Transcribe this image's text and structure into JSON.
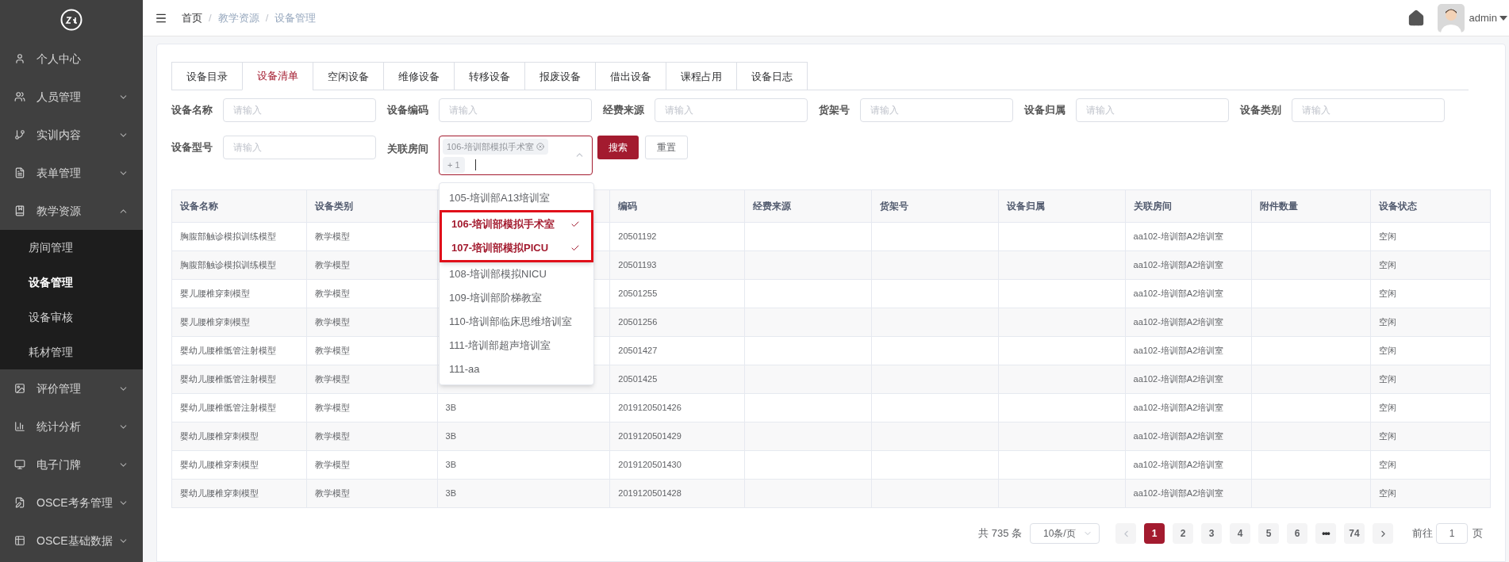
{
  "sidebar": {
    "items": [
      {
        "label": "个人中心"
      },
      {
        "label": "人员管理",
        "expanded": false
      },
      {
        "label": "实训内容",
        "expanded": false
      },
      {
        "label": "表单管理",
        "expanded": false
      },
      {
        "label": "教学资源",
        "expanded": true,
        "children": [
          {
            "label": "房间管理",
            "selected": false
          },
          {
            "label": "设备管理",
            "selected": true
          },
          {
            "label": "设备审核",
            "selected": false
          },
          {
            "label": "耗材管理",
            "selected": false
          }
        ]
      },
      {
        "label": "评价管理",
        "expanded": false
      },
      {
        "label": "统计分析",
        "expanded": false
      },
      {
        "label": "电子门牌",
        "expanded": false
      },
      {
        "label": "OSCE考务管理",
        "expanded": false
      },
      {
        "label": "OSCE基础数据",
        "expanded": false
      }
    ]
  },
  "breadcrumb": {
    "separator": "/",
    "items": [
      "首页",
      "教学资源",
      "设备管理"
    ]
  },
  "user": {
    "name": "admin"
  },
  "tabs": [
    {
      "label": "设备目录",
      "selected": false
    },
    {
      "label": "设备清单",
      "selected": true
    },
    {
      "label": "空闲设备",
      "selected": false
    },
    {
      "label": "维修设备",
      "selected": false
    },
    {
      "label": "转移设备",
      "selected": false
    },
    {
      "label": "报废设备",
      "selected": false
    },
    {
      "label": "借出设备",
      "selected": false
    },
    {
      "label": "课程占用",
      "selected": false
    },
    {
      "label": "设备日志",
      "selected": false
    }
  ],
  "filters": [
    {
      "kind": "input",
      "label": "设备名称",
      "placeholder": "请输入"
    },
    {
      "kind": "input",
      "label": "设备编码",
      "placeholder": "请输入"
    },
    {
      "kind": "input",
      "label": "经费来源",
      "placeholder": "请输入"
    },
    {
      "kind": "input",
      "label": "货架号",
      "placeholder": "请输入"
    },
    {
      "kind": "input",
      "label": "设备归属",
      "placeholder": "请输入"
    },
    {
      "kind": "input",
      "label": "设备类别",
      "placeholder": "请输入"
    },
    {
      "kind": "input",
      "label": "设备型号",
      "placeholder": "请输入"
    },
    {
      "kind": "select",
      "label": "关联房间",
      "tags": [
        "106-培训部模拟手术室"
      ],
      "more": "+ 1",
      "open": true
    }
  ],
  "buttons": [
    {
      "label": "搜索",
      "kind": "primary"
    },
    {
      "label": "重置",
      "kind": "default"
    }
  ],
  "dropdown": {
    "highlight_selected": true,
    "options": [
      {
        "label": "105-培训部A13培训室",
        "selected": false
      },
      {
        "label": "106-培训部模拟手术室",
        "selected": true
      },
      {
        "label": "107-培训部模拟PICU",
        "selected": true
      },
      {
        "label": "108-培训部模拟NICU",
        "selected": false
      },
      {
        "label": "109-培训部阶梯教室",
        "selected": false
      },
      {
        "label": "110-培训部临床思维培训室",
        "selected": false
      },
      {
        "label": "111-培训部超声培训室",
        "selected": false
      },
      {
        "label": "111-aa",
        "selected": false
      }
    ]
  },
  "table": {
    "headers": {
      "column_1": "设备名称",
      "column_2": "设备类别",
      "column_4": "编码",
      "column_5": "经费来源",
      "column_6": "货架号",
      "column_7": "设备归属",
      "column_8": "关联房间",
      "column_9": "附件数量",
      "column_10": "设备状态"
    },
    "rows": [
      {
        "column_1": "胸腹部触诊模拟训练模型",
        "column_2": "教学模型",
        "column_4": "20501192",
        "column_8": "aa102-培训部A2培训室",
        "column_10": "空闲"
      },
      {
        "column_1": "胸腹部触诊模拟训练模型",
        "column_2": "教学模型",
        "column_4": "20501193",
        "column_8": "aa102-培训部A2培训室",
        "column_10": "空闲"
      },
      {
        "column_1": "婴儿腰椎穿刺模型",
        "column_2": "教学模型",
        "column_4": "20501255",
        "column_8": "aa102-培训部A2培训室",
        "column_10": "空闲"
      },
      {
        "column_1": "婴儿腰椎穿刺模型",
        "column_2": "教学模型",
        "column_4": "20501256",
        "column_8": "aa102-培训部A2培训室",
        "column_10": "空闲"
      },
      {
        "column_1": "婴幼儿腰椎骶管注射模型",
        "column_2": "教学模型",
        "column_4": "20501427",
        "column_8": "aa102-培训部A2培训室",
        "column_10": "空闲"
      },
      {
        "column_1": "婴幼儿腰椎骶管注射模型",
        "column_2": "教学模型",
        "column_4": "20501425",
        "column_8": "aa102-培训部A2培训室",
        "column_10": "空闲"
      },
      {
        "column_1": "婴幼儿腰椎骶管注射模型",
        "column_2": "教学模型",
        "column_3": "3B",
        "column_4": "2019120501426",
        "column_8": "aa102-培训部A2培训室",
        "column_10": "空闲"
      },
      {
        "column_1": "婴幼儿腰椎穿刺模型",
        "column_2": "教学模型",
        "column_3": "3B",
        "column_4": "2019120501429",
        "column_8": "aa102-培训部A2培训室",
        "column_10": "空闲"
      },
      {
        "column_1": "婴幼儿腰椎穿刺模型",
        "column_2": "教学模型",
        "column_3": "3B",
        "column_4": "2019120501430",
        "column_8": "aa102-培训部A2培训室",
        "column_10": "空闲"
      },
      {
        "column_1": "婴幼儿腰椎穿刺模型",
        "column_2": "教学模型",
        "column_3": "3B",
        "column_4": "2019120501428",
        "column_8": "aa102-培训部A2培训室",
        "column_10": "空闲"
      }
    ]
  },
  "pagination": {
    "total": "共 735 条",
    "page_size": "10条/页",
    "pages": [
      {
        "kind": "page",
        "label": "1",
        "selected": true
      },
      {
        "kind": "page",
        "label": "2",
        "selected": false
      },
      {
        "kind": "page",
        "label": "3",
        "selected": false
      },
      {
        "kind": "page",
        "label": "4",
        "selected": false
      },
      {
        "kind": "page",
        "label": "5",
        "selected": false
      },
      {
        "kind": "page",
        "label": "6",
        "selected": false
      },
      {
        "kind": "more",
        "label": "•••",
        "selected": false
      },
      {
        "kind": "page",
        "label": "74",
        "selected": false
      }
    ],
    "goto_label": "前往",
    "goto_value": "1",
    "goto_suffix": "页"
  }
}
